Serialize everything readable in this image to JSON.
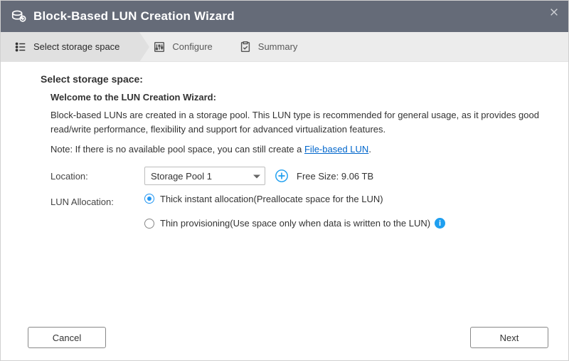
{
  "window": {
    "title": "Block-Based LUN Creation Wizard"
  },
  "steps": {
    "s1": "Select storage space",
    "s2": "Configure",
    "s3": "Summary"
  },
  "page": {
    "heading": "Select storage space:",
    "subheading": "Welcome to the LUN Creation Wizard:",
    "body": "Block-based LUNs are created in a storage pool. This LUN type is recommended for general usage, as it provides good read/write performance, flexibility and support for advanced virtualization features.",
    "note_prefix": "Note: If there is no available pool space, you can still create a ",
    "note_link": "File-based LUN",
    "note_suffix": "."
  },
  "form": {
    "location_label": "Location:",
    "location_value": "Storage Pool 1",
    "free_size_label": "Free Size: 9.06 TB",
    "allocation_label": "LUN Allocation:",
    "option_thick": "Thick instant allocation(Preallocate space for the LUN)",
    "option_thin": "Thin provisioning(Use space only when data is written to the LUN)",
    "selected_allocation": "thick"
  },
  "buttons": {
    "cancel": "Cancel",
    "next": "Next"
  }
}
